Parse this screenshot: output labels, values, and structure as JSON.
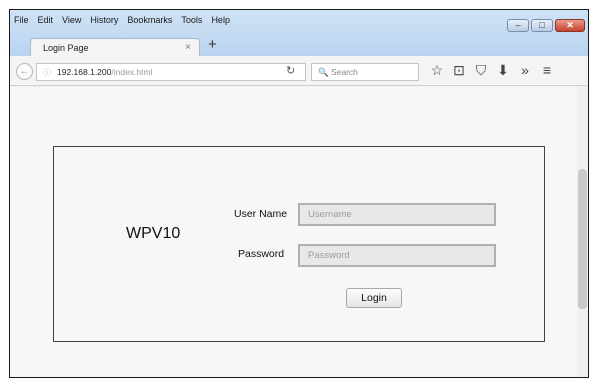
{
  "menu": [
    "File",
    "Edit",
    "View",
    "History",
    "Bookmarks",
    "Tools",
    "Help"
  ],
  "window_controls": {
    "minimize": "–",
    "maximize": "□",
    "close": "✕"
  },
  "tab": {
    "title": "Login Page",
    "close": "×",
    "new_tab": "+"
  },
  "url": {
    "host": "192.168.1.200",
    "path": "/index.html"
  },
  "search": {
    "placeholder": "Search"
  },
  "toolbar_icons": [
    "star-icon",
    "reading-list-icon",
    "pocket-icon",
    "download-icon",
    "overflow-icon",
    "menu-icon"
  ],
  "toolbar_glyphs": {
    "star": "☆",
    "reading": "⊡",
    "pocket": "⛉",
    "download": "⬇",
    "overflow": "»",
    "menu": "≡"
  },
  "login": {
    "product_name": "WPV10",
    "username_label": "User Name",
    "username_placeholder": "Username",
    "password_label": "Password",
    "password_placeholder": "Password",
    "login_button": "Login"
  },
  "colors": {
    "titlebar": "#c3d9f2",
    "close_button": "#c6412f"
  }
}
